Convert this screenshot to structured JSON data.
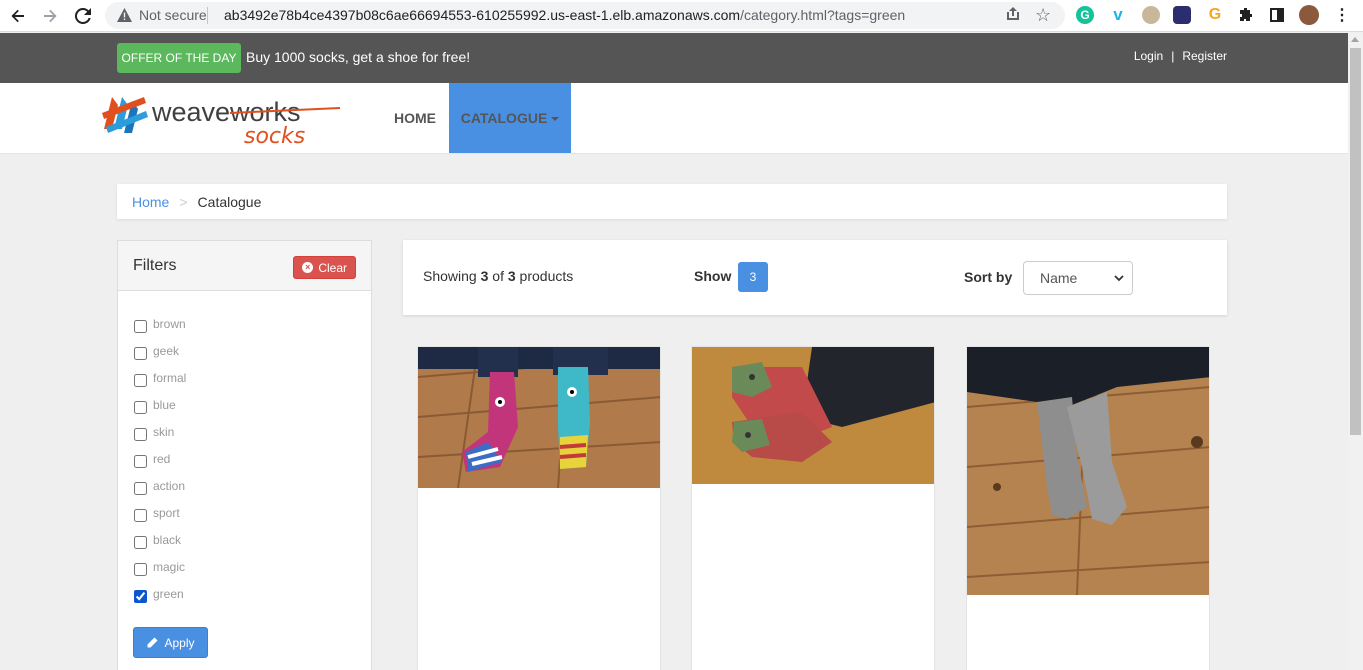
{
  "browser": {
    "not_secure": "Not secure",
    "url_host": "ab3492e78b4ce4397b08c6ae66694553-610255992.us-east-1.elb.amazonaws.com",
    "url_path": "/category.html?tags=green"
  },
  "topbar": {
    "offer_badge": "OFFER OF THE DAY",
    "offer_text": "Buy 1000 socks, get a shoe for free!",
    "login": "Login",
    "separator": "|",
    "register": "Register"
  },
  "navbar": {
    "logo_word1": "weave",
    "logo_word2": "works",
    "logo_word3": "socks",
    "home": "HOME",
    "catalogue": "CATALOGUE"
  },
  "breadcrumb": {
    "home": "Home",
    "separator": ">",
    "current": "Catalogue"
  },
  "filters": {
    "title": "Filters",
    "clear": "Clear",
    "apply": "Apply",
    "items": [
      {
        "label": "brown",
        "checked": false
      },
      {
        "label": "geek",
        "checked": false
      },
      {
        "label": "formal",
        "checked": false
      },
      {
        "label": "blue",
        "checked": false
      },
      {
        "label": "skin",
        "checked": false
      },
      {
        "label": "red",
        "checked": false
      },
      {
        "label": "action",
        "checked": false
      },
      {
        "label": "sport",
        "checked": false
      },
      {
        "label": "black",
        "checked": false
      },
      {
        "label": "magic",
        "checked": false
      },
      {
        "label": "green",
        "checked": true
      }
    ]
  },
  "products_header": {
    "showing_prefix": "Showing ",
    "showing_count": "3",
    "showing_of": " of ",
    "showing_total": "3",
    "showing_suffix": " products",
    "show_label": "Show",
    "show_value": "3",
    "sort_label": "Sort by",
    "sort_value": "Name"
  },
  "colors": {
    "accent": "#4a90e2",
    "success": "#5cb85c",
    "danger": "#d9534f",
    "topbar": "#555555"
  }
}
